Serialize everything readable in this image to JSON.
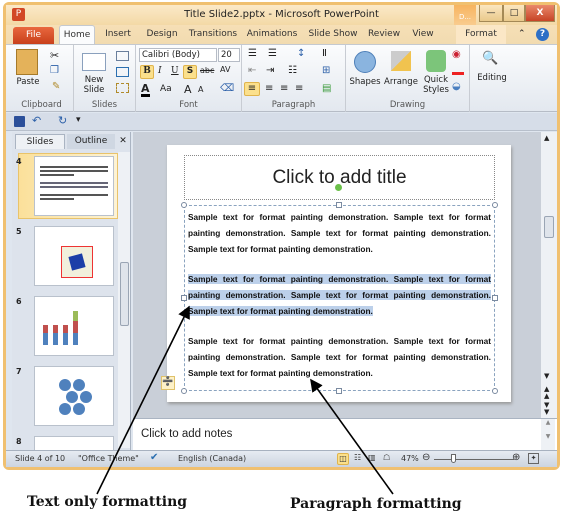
{
  "window": {
    "title": "Title Slide2.pptx  -  Microsoft PowerPoint",
    "context_tab": "D...",
    "min": "—",
    "max": "□",
    "close": "X"
  },
  "tabs": [
    "File",
    "Home",
    "Insert",
    "Design",
    "Transitions",
    "Animations",
    "Slide Show",
    "Review",
    "View",
    "Format"
  ],
  "ribbon": {
    "clipboard": {
      "label": "Clipboard",
      "paste": "Paste"
    },
    "slides": {
      "label": "Slides",
      "new_slide": "New Slide"
    },
    "font": {
      "label": "Font",
      "font_name": "Calibri (Body)",
      "font_size": "20",
      "bold": "B",
      "italic": "I",
      "underline": "U",
      "shadow": "S",
      "strike": "abc",
      "spacing": "AV",
      "color": "A",
      "case": "Aa",
      "grow": "A",
      "shrink": "A"
    },
    "paragraph": {
      "label": "Paragraph"
    },
    "drawing": {
      "label": "Drawing",
      "shapes": "Shapes",
      "arrange": "Arrange",
      "quick_styles": "Quick Styles"
    },
    "editing": {
      "label": "Editing"
    }
  },
  "panel": {
    "tabs": [
      "Slides",
      "Outline"
    ],
    "close": "✕",
    "slide_numbers": [
      "4",
      "5",
      "6",
      "7",
      "8"
    ]
  },
  "slide": {
    "title_placeholder": "Click to add title",
    "paragraphs": [
      "Sample text for format painting demonstration. Sample text for format painting demonstration. Sample text for format painting demonstration. Sample text for format painting demonstration.",
      "Sample text for format painting demonstration. Sample text for format painting demonstration. Sample text for format painting demonstration. Sample text for format painting demonstration.",
      "Sample text for format painting demonstration. Sample text for format painting demonstration. Sample text for format painting demonstration. Sample text for format painting demonstration."
    ]
  },
  "notes": {
    "placeholder": "Click to add notes"
  },
  "status": {
    "slide": "Slide 4 of 10",
    "theme": "\"Office Theme\"",
    "language": "English (Canada)",
    "zoom": "47%",
    "zoom_percent": 47
  },
  "annotations": {
    "left": "Text only formatting",
    "right": "Paragraph formatting"
  },
  "colors": {
    "file_tab": "#d24726",
    "highlight": "#bcd0ea",
    "frame": "#f0c070"
  }
}
